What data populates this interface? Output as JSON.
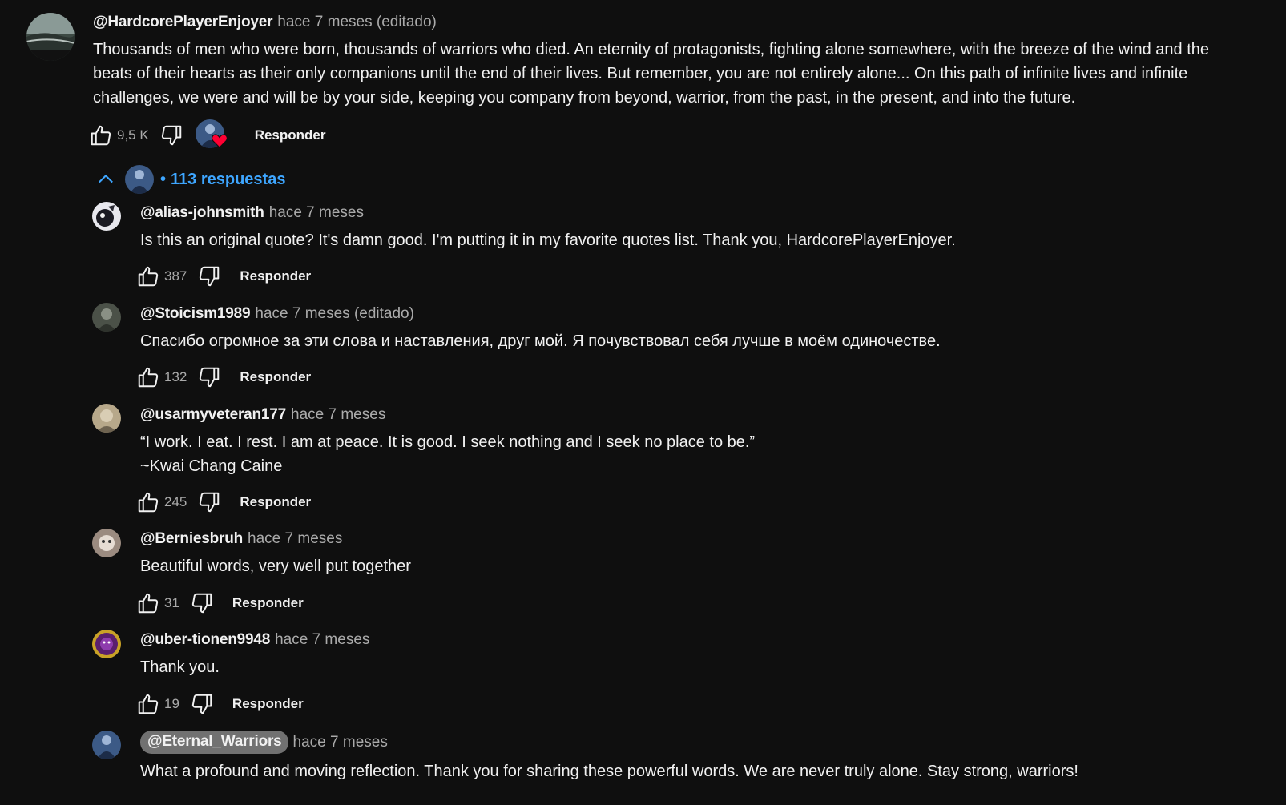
{
  "top_comment": {
    "author": "@HardcorePlayerEnjoyer",
    "time": "hace 7 meses (editado)",
    "lines": [
      "Thousands of men who were born, thousands of warriors who died. An eternity of protagonists, fighting alone somewhere, with the breeze of the wind and the",
      "beats of their hearts as their only companions until the end of their lives. But remember, you are not entirely alone... On this path of infinite lives and infinite",
      "challenges, we were and will be by your side, keeping you company from beyond, warrior, from the past, in the present, and into the future."
    ],
    "likes": "9,5 K",
    "reply_label": "Responder"
  },
  "replies_toggle": {
    "label": "113 respuestas",
    "bullet": "•"
  },
  "replies": [
    {
      "author": "@alias-johnsmith",
      "time": "hace 7 meses",
      "lines": [
        "Is this an original quote? It's damn good. I'm putting it in my favorite quotes list. Thank you, HardcorePlayerEnjoyer."
      ],
      "likes": "387",
      "reply_label": "Responder"
    },
    {
      "author": "@Stoicism1989",
      "time": "hace 7 meses (editado)",
      "lines": [
        "Спасибо огромное за эти слова и наставления, друг мой. Я почувствовал себя лучше в моём одиночестве."
      ],
      "likes": "132",
      "reply_label": "Responder"
    },
    {
      "author": "@usarmyveteran177",
      "time": "hace 7 meses",
      "lines": [
        "“I work. I eat. I rest. I am at peace. It is good. I seek nothing and I seek no place to be.”",
        "~Kwai Chang Caine"
      ],
      "likes": "245",
      "reply_label": "Responder"
    },
    {
      "author": "@Berniesbruh",
      "time": "hace 7 meses",
      "lines": [
        "Beautiful words, very well put together"
      ],
      "likes": "31",
      "reply_label": "Responder"
    },
    {
      "author": "@uber-tionen9948",
      "time": "hace 7 meses",
      "lines": [
        "Thank you."
      ],
      "likes": "19",
      "reply_label": "Responder"
    },
    {
      "author": "@Eternal_Warriors",
      "time": "hace 7 meses",
      "lines": [
        "What a profound and moving reflection. Thank you for sharing these powerful words. We are never truly alone. Stay strong, warriors!"
      ]
    }
  ],
  "icons": {
    "like": "thumbs-up-icon",
    "dislike": "thumbs-down-icon",
    "creator_heart": "heart-icon",
    "collapse": "chevron-up-icon"
  },
  "colors": {
    "background": "#0f0f0f",
    "link_blue": "#3ea6ff",
    "heart_red": "#ff0033",
    "muted": "#aaaaaa",
    "badge_bg": "#717171"
  }
}
